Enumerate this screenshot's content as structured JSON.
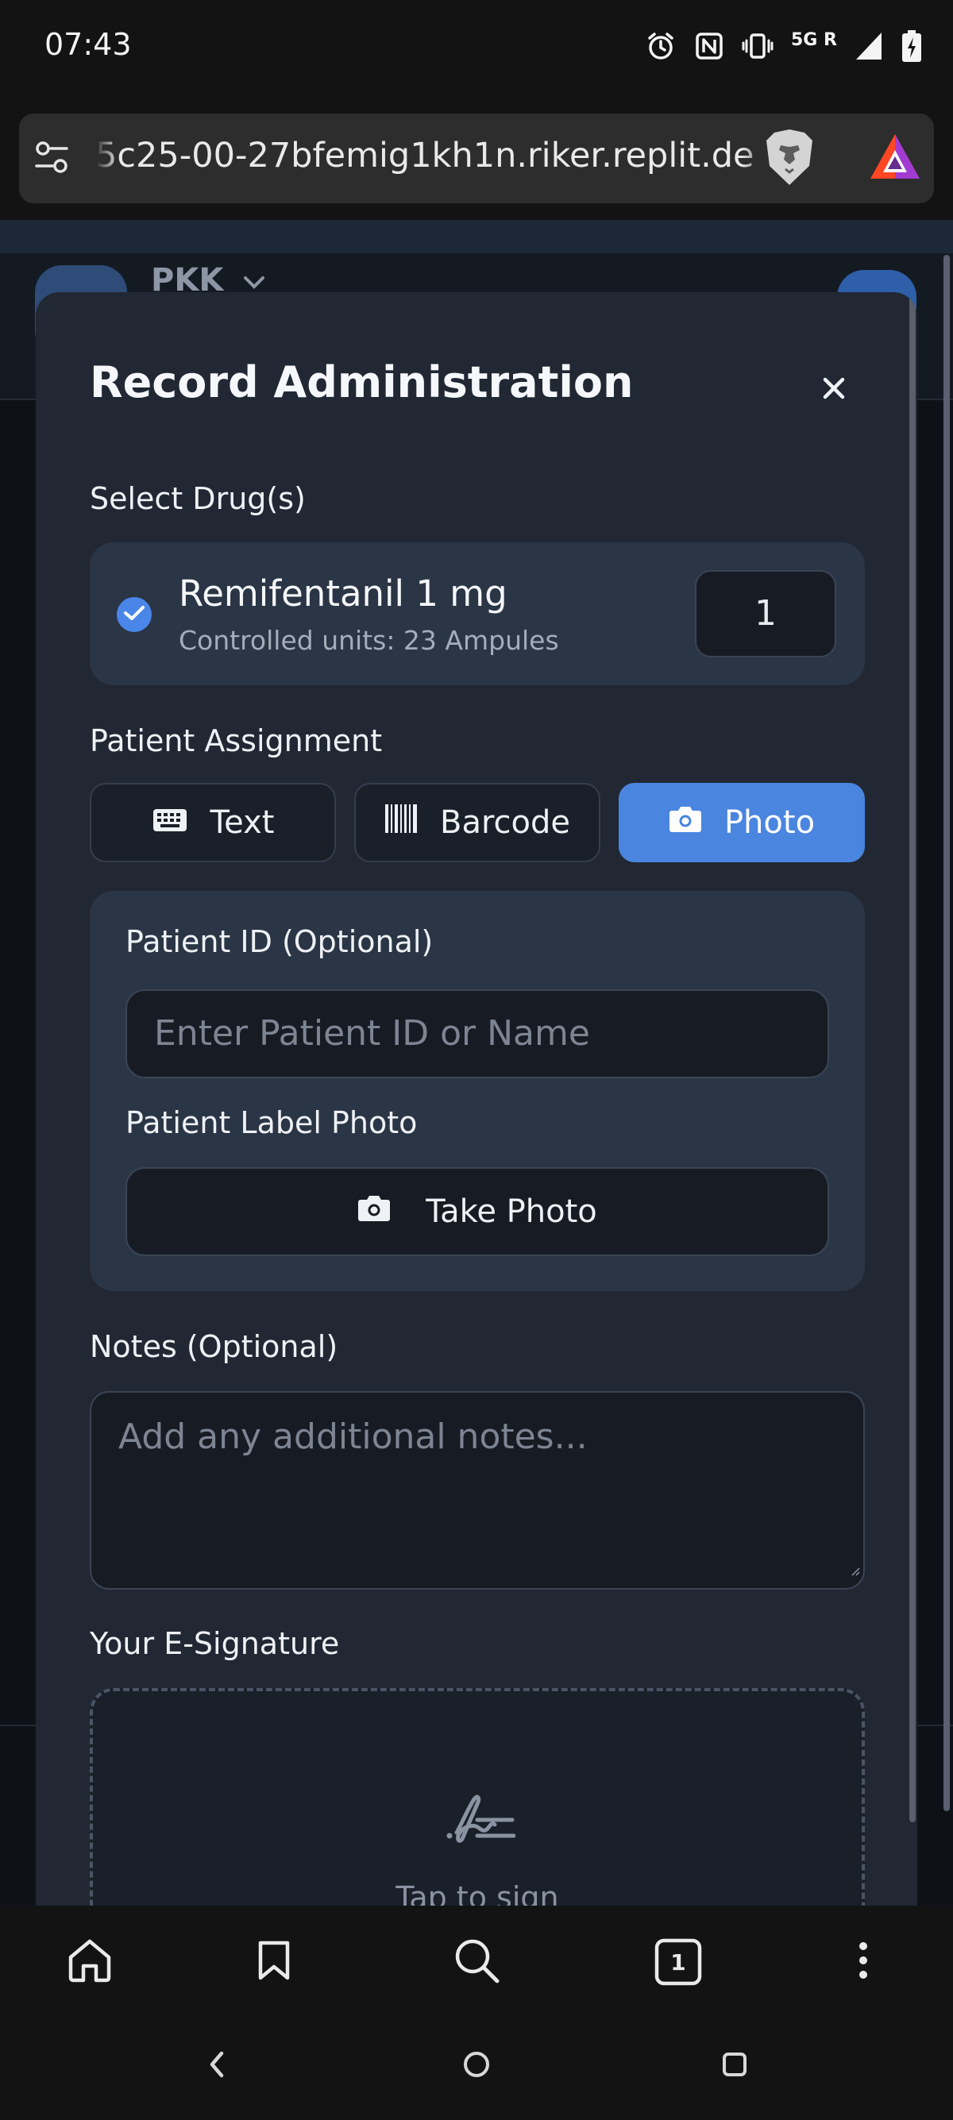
{
  "status_bar": {
    "time": "07:43",
    "network": "5G",
    "network_sup": "R"
  },
  "browser": {
    "url": "5c25-00-27bfemig1kh1n.riker.replit.dev",
    "tab_count": "1"
  },
  "page": {
    "header_title": "PKK"
  },
  "modal": {
    "title": "Record Administration",
    "select_drugs_label": "Select Drug(s)",
    "drug": {
      "name": "Remifentanil 1 mg",
      "sub": "Controlled units: 23 Ampules",
      "quantity": "1",
      "selected": true
    },
    "patient_assignment_label": "Patient Assignment",
    "assignment_modes": [
      {
        "label": "Text",
        "icon": "keyboard-icon",
        "active": false
      },
      {
        "label": "Barcode",
        "icon": "barcode-icon",
        "active": false
      },
      {
        "label": "Photo",
        "icon": "camera-icon",
        "active": true
      }
    ],
    "patient_id_label": "Patient ID (Optional)",
    "patient_id_placeholder": "Enter Patient ID or Name",
    "patient_photo_label": "Patient Label Photo",
    "take_photo_label": "Take Photo",
    "notes_label": "Notes (Optional)",
    "notes_placeholder": "Add any additional notes...",
    "signature_label": "Your E-Signature",
    "signature_hint": "Tap to sign"
  },
  "colors": {
    "accent": "#4a85e0",
    "modal_bg": "#212834",
    "card_bg": "#2a3545"
  }
}
